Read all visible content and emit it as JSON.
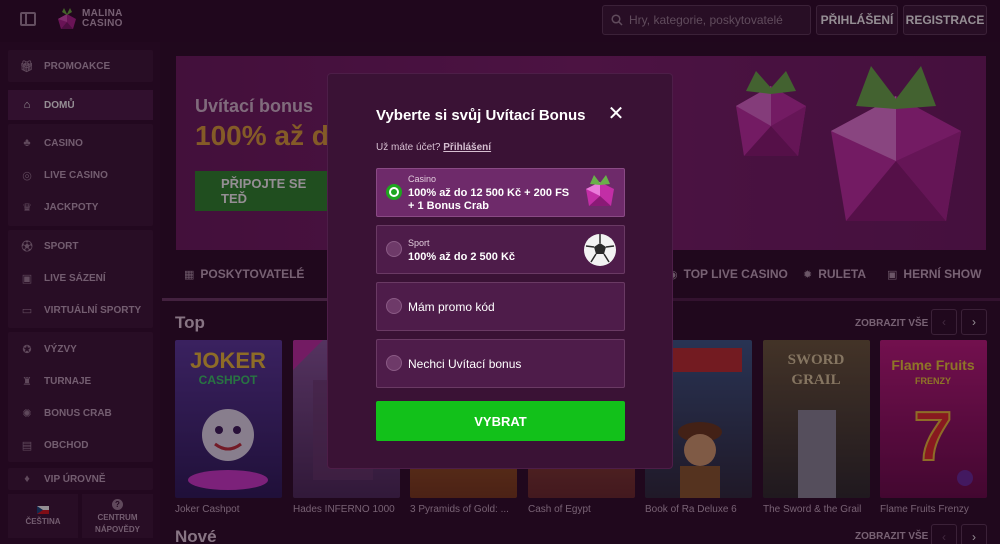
{
  "header": {
    "logo_line1": "MALINA",
    "logo_line2": "CASINO",
    "search_placeholder": "Hry, kategorie, poskytovatelé",
    "login_label": "PŘIHLÁŠENÍ",
    "register_label": "REGISTRACE"
  },
  "sidebar": {
    "items": [
      {
        "label": "PROMOAKCE",
        "icon": "gift-icon"
      },
      {
        "label": "DOMŮ",
        "icon": "home-icon"
      },
      {
        "label": "CASINO",
        "icon": "casino-icon"
      },
      {
        "label": "LIVE CASINO",
        "icon": "live-casino-icon"
      },
      {
        "label": "JACKPOTY",
        "icon": "jackpot-icon"
      },
      {
        "label": "SPORT",
        "icon": "sport-icon"
      },
      {
        "label": "LIVE SÁZENÍ",
        "icon": "live-betting-icon"
      },
      {
        "label": "VIRTUÁLNÍ SPORTY",
        "icon": "virtual-sports-icon"
      },
      {
        "label": "VÝZVY",
        "icon": "challenges-icon"
      },
      {
        "label": "TURNAJE",
        "icon": "trophy-icon"
      },
      {
        "label": "BONUS CRAB",
        "icon": "crab-icon"
      },
      {
        "label": "OBCHOD",
        "icon": "shop-icon"
      },
      {
        "label": "VIP ÚROVNĚ",
        "icon": "vip-icon"
      }
    ],
    "language_label": "ČEŠTINA",
    "help_label_line1": "CENTRUM",
    "help_label_line2": "NÁPOVĚDY"
  },
  "banner": {
    "title": "Uvítací bonus",
    "amount": "100% až d",
    "cta": "PŘIPOJTE SE TEĎ"
  },
  "tabs": [
    {
      "label": "POSKYTOVATELÉ",
      "icon": "grid-icon"
    },
    {
      "label": "TOP LIVE CASINO",
      "icon": "live-casino-icon"
    },
    {
      "label": "RULETA",
      "icon": "roulette-icon"
    },
    {
      "label": "HERNÍ SHOW",
      "icon": "tv-icon"
    }
  ],
  "sections": {
    "top_title": "Top",
    "new_title": "Nové",
    "show_all": "ZOBRAZIT VŠE"
  },
  "games": [
    {
      "name": "Joker Cashpot",
      "color": "#3b2a6e"
    },
    {
      "name": "Hades INFERNO 1000",
      "color": "#6a2d6e"
    },
    {
      "name": "3 Pyramids of Gold: ...",
      "color": "#8a4f1e"
    },
    {
      "name": "Cash of Egypt",
      "color": "#7a3a2a"
    },
    {
      "name": "Book of Ra Deluxe 6",
      "color": "#2a3d5a"
    },
    {
      "name": "The Sword & the Grail",
      "color": "#4a3a2a"
    },
    {
      "name": "Flame Fruits Frenzy",
      "color": "#a0146e"
    }
  ],
  "modal": {
    "title": "Vyberte si svůj Uvítací Bonus",
    "account_prompt": "Už máte účet?",
    "account_link": "Přihlášení",
    "options": [
      {
        "type": "Casino",
        "value": "100% až do 12 500 Kč + 200 FS + 1 Bonus Crab",
        "selected": true,
        "icon": "raspberry-icon"
      },
      {
        "type": "Sport",
        "value": "100% až do 2 500 Kč",
        "selected": false,
        "icon": "soccer-ball-icon"
      },
      {
        "label": "Mám promo kód",
        "selected": false
      },
      {
        "label": "Nechci Uvítací bonus",
        "selected": false
      }
    ],
    "submit_label": "VYBRAT"
  },
  "colors": {
    "accent_green": "#12c11a",
    "brand_purple": "#3a1235",
    "banner_gold": "#e0a33a"
  }
}
